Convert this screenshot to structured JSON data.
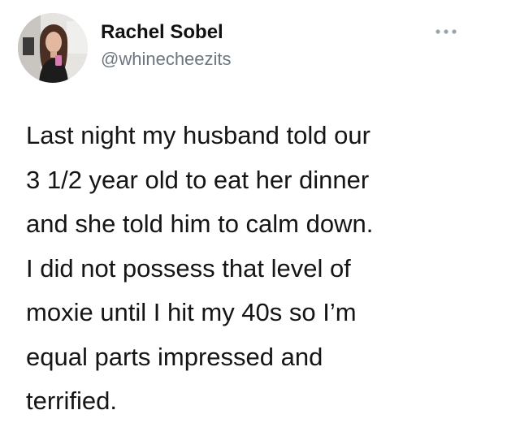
{
  "tweet": {
    "author": {
      "display_name": "Rachel Sobel",
      "handle": "@whinecheezits"
    },
    "more_icon": "more-options-icon",
    "body_lines": [
      "Last night my husband told our",
      "3 1/2 year old to eat her dinner",
      "and she told him to calm down.",
      "I did not possess that level of",
      "moxie until I hit my 40s so I’m",
      "equal parts impressed and",
      "terrified."
    ]
  },
  "colors": {
    "background": "#ffffff",
    "name_text": "#111111",
    "handle_text": "#6b7680",
    "body_text": "#151515",
    "icon_gray": "#9aa4ad"
  }
}
